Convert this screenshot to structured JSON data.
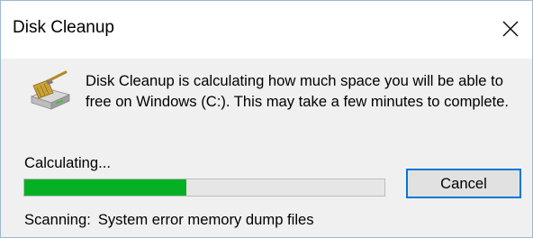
{
  "window": {
    "title": "Disk Cleanup"
  },
  "icons": {
    "app_icon": "disk-cleanup-icon",
    "close_icon": "close-icon"
  },
  "message": "Disk Cleanup is calculating how much space you will be able to free on Windows (C:). This may take a few minutes to complete.",
  "status": {
    "label": "Calculating...",
    "progress_percent": 45
  },
  "buttons": {
    "cancel_label": "Cancel"
  },
  "scan": {
    "label": "Scanning:",
    "item": "System error memory dump files"
  },
  "colors": {
    "progress_fill": "#06b025",
    "progress_track": "#e6e6e6",
    "focus_border": "#0078d7",
    "window_border": "#9ab8d4"
  }
}
